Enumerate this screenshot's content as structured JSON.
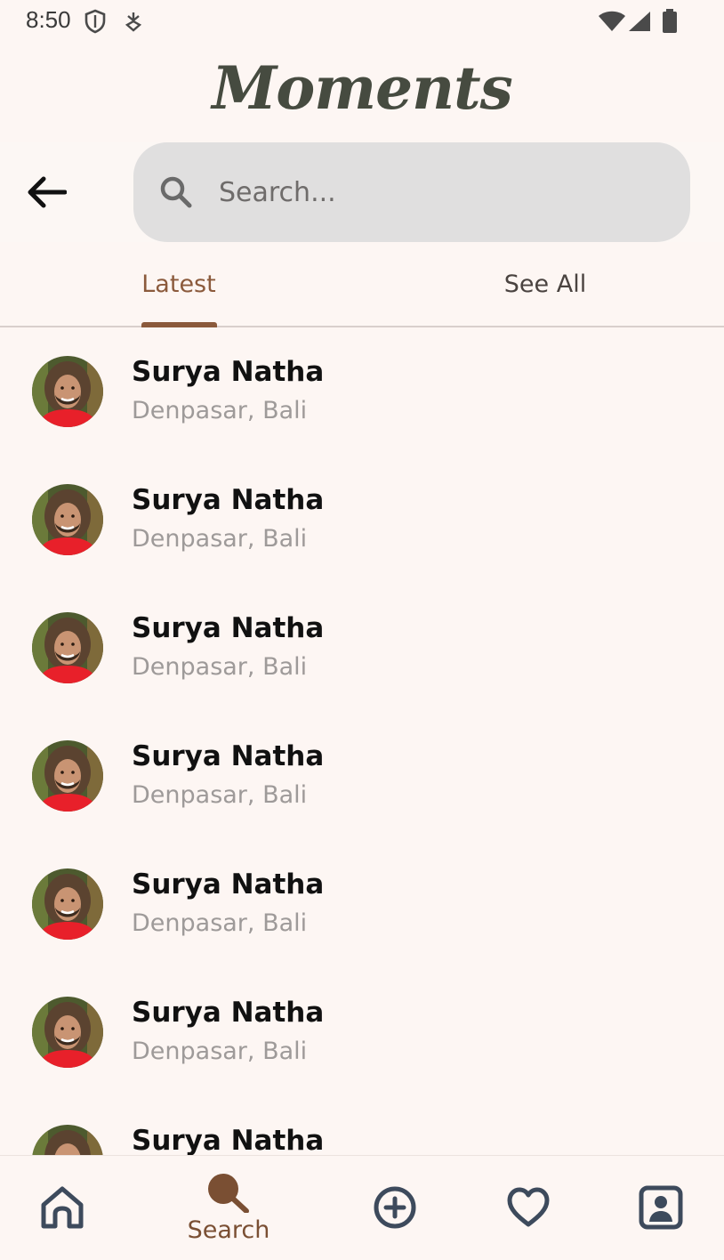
{
  "status_bar": {
    "time": "8:50"
  },
  "app": {
    "title": "Moments"
  },
  "search": {
    "placeholder": "Search..."
  },
  "tabs": [
    {
      "label": "Latest",
      "active": true
    },
    {
      "label": "See All",
      "active": false
    }
  ],
  "users": [
    {
      "name": "Surya Natha",
      "location": "Denpasar, Bali"
    },
    {
      "name": "Surya Natha",
      "location": "Denpasar, Bali"
    },
    {
      "name": "Surya Natha",
      "location": "Denpasar, Bali"
    },
    {
      "name": "Surya Natha",
      "location": "Denpasar, Bali"
    },
    {
      "name": "Surya Natha",
      "location": "Denpasar, Bali"
    },
    {
      "name": "Surya Natha",
      "location": "Denpasar, Bali"
    },
    {
      "name": "Surya Natha",
      "location": ""
    }
  ],
  "bottom_nav": {
    "items": [
      {
        "icon": "home-icon",
        "label": ""
      },
      {
        "icon": "search-icon",
        "label": "Search",
        "active": true
      },
      {
        "icon": "add-icon",
        "label": ""
      },
      {
        "icon": "heart-icon",
        "label": ""
      },
      {
        "icon": "profile-icon",
        "label": ""
      }
    ]
  },
  "colors": {
    "background": "#fdf6f3",
    "accent": "#8b5a3c",
    "title": "#464b40",
    "search_bg": "#e0dfdf",
    "nav_icon": "#3d4a5c"
  }
}
